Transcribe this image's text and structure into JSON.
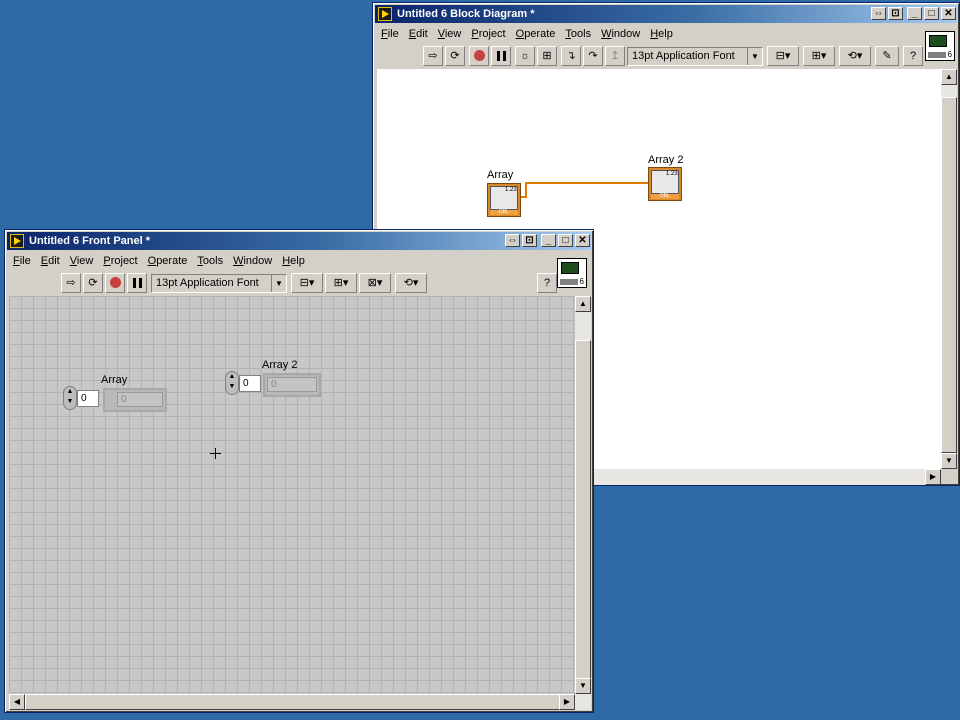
{
  "block_diagram": {
    "title": "Untitled 6 Block Diagram *",
    "menus": [
      {
        "label": "File",
        "key": "F",
        "rest": "ile"
      },
      {
        "label": "Edit",
        "key": "E",
        "rest": "dit"
      },
      {
        "label": "View",
        "key": "V",
        "rest": "iew"
      },
      {
        "label": "Project",
        "key": "P",
        "rest": "roject"
      },
      {
        "label": "Operate",
        "key": "O",
        "rest": "perate"
      },
      {
        "label": "Tools",
        "key": "T",
        "rest": "ools"
      },
      {
        "label": "Window",
        "key": "W",
        "rest": "indow"
      },
      {
        "label": "Help",
        "key": "H",
        "rest": "elp"
      }
    ],
    "font": "13pt Application Font",
    "vi_number": "6",
    "nodes": {
      "array_label": "Array",
      "array2_label": "Array 2",
      "dbl": "DBL",
      "num_tag": "1.23"
    }
  },
  "front_panel": {
    "title": "Untitled 6 Front Panel *",
    "menus": [
      {
        "label": "File",
        "key": "F",
        "rest": "ile"
      },
      {
        "label": "Edit",
        "key": "E",
        "rest": "dit"
      },
      {
        "label": "View",
        "key": "V",
        "rest": "iew"
      },
      {
        "label": "Project",
        "key": "P",
        "rest": "roject"
      },
      {
        "label": "Operate",
        "key": "O",
        "rest": "perate"
      },
      {
        "label": "Tools",
        "key": "T",
        "rest": "ools"
      },
      {
        "label": "Window",
        "key": "W",
        "rest": "indow"
      },
      {
        "label": "Help",
        "key": "H",
        "rest": "elp"
      }
    ],
    "font": "13pt Application Font",
    "vi_number": "6",
    "controls": {
      "array_label": "Array",
      "array_index": "0",
      "array_element": "0",
      "array2_label": "Array 2",
      "array2_index": "0",
      "array2_element": "0"
    }
  },
  "icons": {
    "run": "run-arrow-icon",
    "run_continuous": "run-continuously-icon",
    "abort": "abort-stop-icon",
    "pause": "pause-icon",
    "highlight": "highlight-execution-bulb-icon",
    "help": "context-help-icon"
  },
  "colors": {
    "desktop": "#2e6ba6",
    "titlebar": "#0a246a",
    "wire": "#e07a00",
    "node": "#d88a2a"
  }
}
